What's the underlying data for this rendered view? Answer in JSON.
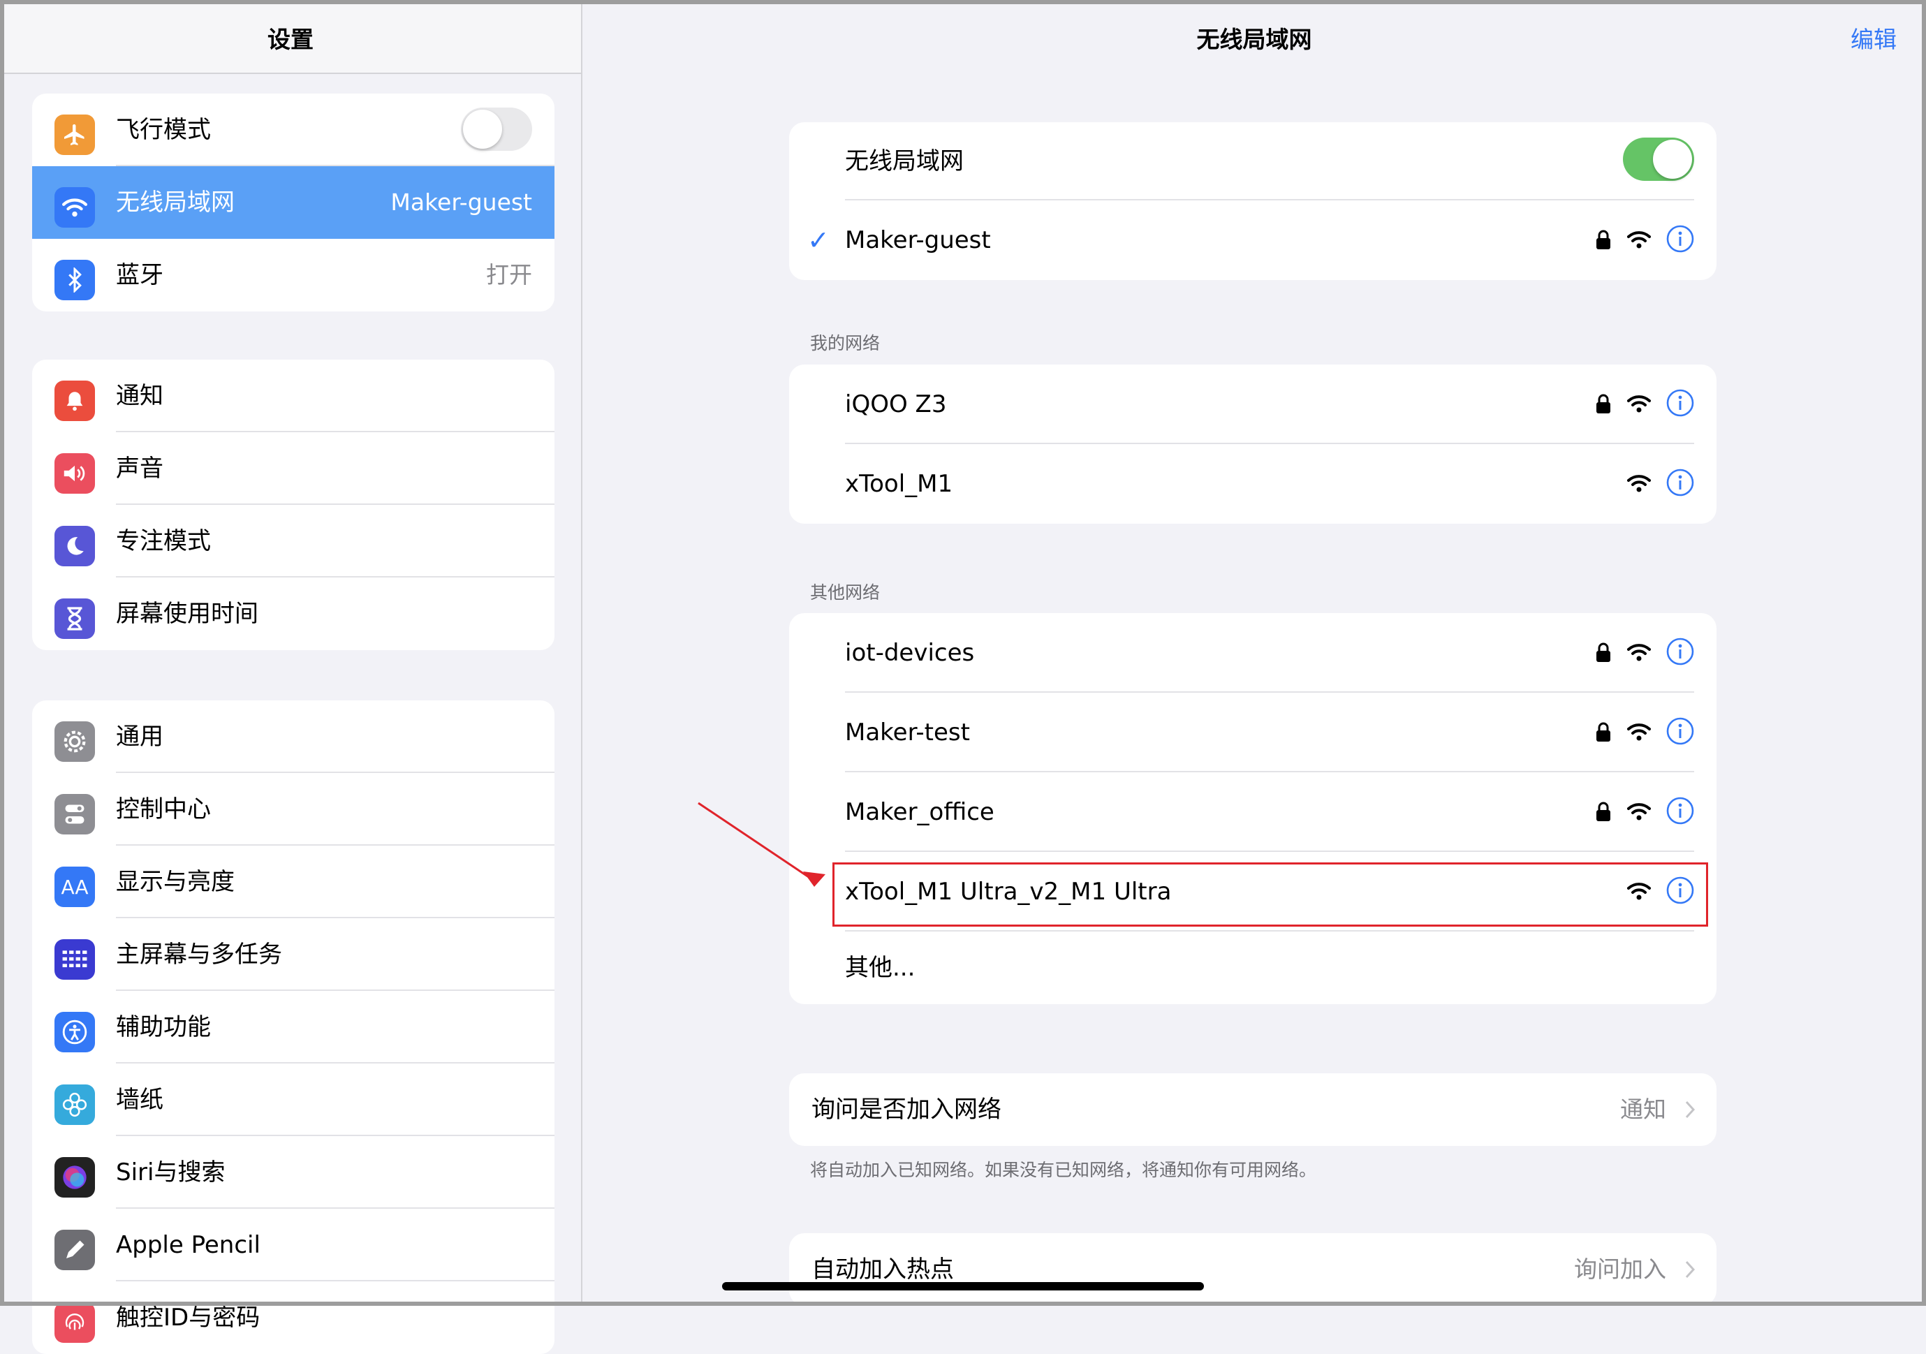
{
  "sidebar": {
    "title": "设置",
    "groups": [
      [
        {
          "label": "飞行模式",
          "icon": "airplane-icon",
          "color": "#f19a37",
          "toggle": false
        },
        {
          "label": "无线局域网",
          "icon": "wifi-icon",
          "color": "#3478f6",
          "value": "Maker-guest",
          "selected": true
        },
        {
          "label": "蓝牙",
          "icon": "bluetooth-icon",
          "color": "#3478f6",
          "value": "打开"
        }
      ],
      [
        {
          "label": "通知",
          "icon": "bell-icon",
          "color": "#eb4d3d"
        },
        {
          "label": "声音",
          "icon": "speaker-icon",
          "color": "#eb4e5e"
        },
        {
          "label": "专注模式",
          "icon": "moon-icon",
          "color": "#5856d6"
        },
        {
          "label": "屏幕使用时间",
          "icon": "hourglass-icon",
          "color": "#5856d6"
        }
      ],
      [
        {
          "label": "通用",
          "icon": "gear-icon",
          "color": "#8e8e93"
        },
        {
          "label": "控制中心",
          "icon": "switches-icon",
          "color": "#8e8e93"
        },
        {
          "label": "显示与亮度",
          "icon": "text-size-icon",
          "color": "#3478f6",
          "glyph": "AA"
        },
        {
          "label": "主屏幕与多任务",
          "icon": "grid-icon",
          "color": "#3a3ad1"
        },
        {
          "label": "辅助功能",
          "icon": "accessibility-icon",
          "color": "#3478f6"
        },
        {
          "label": "墙纸",
          "icon": "flower-icon",
          "color": "#35aadc"
        },
        {
          "label": "Siri与搜索",
          "icon": "siri-icon",
          "color": "#222222"
        },
        {
          "label": "Apple Pencil",
          "icon": "pencil-icon",
          "color": "#6e6e73"
        },
        {
          "label": "触控ID与密码",
          "icon": "fingerprint-icon",
          "color": "#eb4e5e"
        }
      ]
    ]
  },
  "main": {
    "title": "无线局域网",
    "edit_label": "编辑",
    "wifi_toggle_label": "无线局域网",
    "wifi_on": true,
    "connected": {
      "name": "Maker-guest",
      "locked": true
    },
    "my_networks_label": "我的网络",
    "my_networks": [
      {
        "name": "iQOO Z3",
        "locked": true
      },
      {
        "name": "xTool_M1",
        "locked": false
      }
    ],
    "other_networks_label": "其他网络",
    "other_networks": [
      {
        "name": "iot-devices",
        "locked": true
      },
      {
        "name": "Maker-test",
        "locked": true
      },
      {
        "name": "Maker_office",
        "locked": true
      },
      {
        "name": "xTool_M1 Ultra_v2_M1 Ultra",
        "locked": false,
        "highlighted": true
      }
    ],
    "other_label": "其他...",
    "ask_join": {
      "label": "询问是否加入网络",
      "value": "通知"
    },
    "ask_join_footer": "将自动加入已知网络。如果没有已知网络，将通知你有可用网络。",
    "auto_hotspot": {
      "label": "自动加入热点",
      "value": "询问加入"
    }
  },
  "colors": {
    "accent": "#3478f6",
    "toggle_on": "#65c466",
    "highlight": "#e0242b"
  }
}
